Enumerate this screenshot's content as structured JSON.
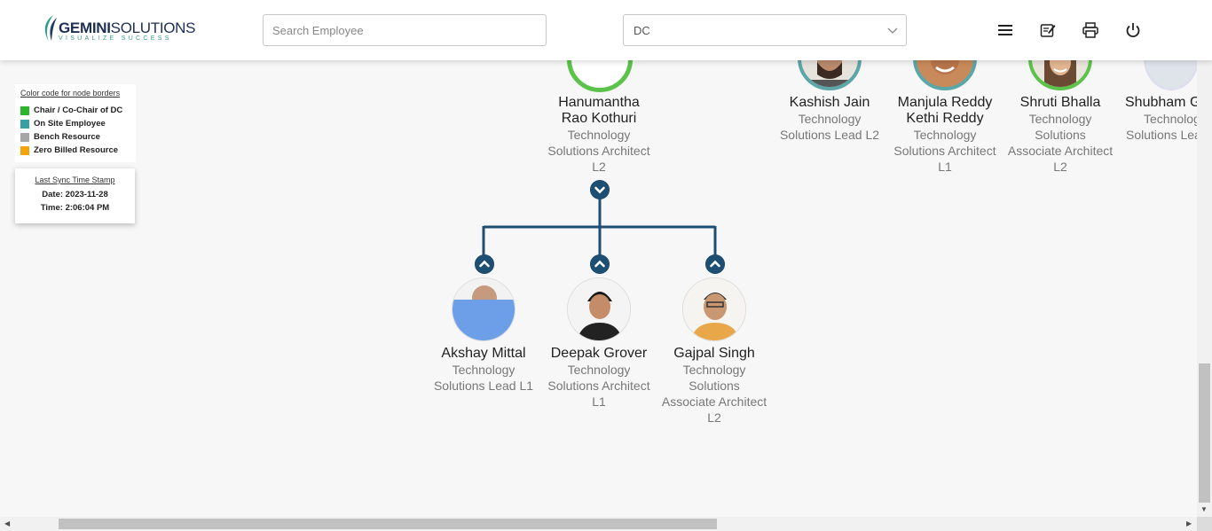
{
  "app": {
    "brand": "GEMINI",
    "brand_suffix": "SOLUTIONS",
    "tagline": "VISUALIZE SUCCESS"
  },
  "header": {
    "search_placeholder": "Search Employee",
    "search_value": "",
    "dc_select": "DC",
    "icons": [
      "menu-icon",
      "notes-icon",
      "print-icon",
      "power-icon"
    ]
  },
  "legend": {
    "title": "Color code for node borders",
    "items": [
      {
        "label": "Chair / Co-Chair of DC",
        "color": "#2db52d"
      },
      {
        "label": "On Site Employee",
        "color": "#3a9fa0"
      },
      {
        "label": "Bench Resource",
        "color": "#a6a6a6"
      },
      {
        "label": "Zero Billed Resource",
        "color": "#f5a50a"
      }
    ]
  },
  "sync": {
    "title": "Last Sync Time Stamp",
    "date": "Date: 2023-11-28",
    "time": "Time: 2:06:04 PM"
  },
  "colors": {
    "connector": "#1f4e73",
    "chair_border": "#5bc24a",
    "onsite_border": "#5aa6a8"
  },
  "nodes": {
    "parent": {
      "name": "Hanumantha Rao Kothuri",
      "name_l1": "Hanumantha",
      "name_l2": "Rao Kothuri",
      "role_l1": "Technology",
      "role_l2": "Solutions Architect",
      "role_l3": "L2"
    },
    "top_row": [
      {
        "name": "Kashish Jain",
        "role_l1": "Technology",
        "role_l2": "Solutions Lead L2"
      },
      {
        "name_l1": "Manjula Reddy",
        "name_l2": "Kethi Reddy",
        "role_l1": "Technology",
        "role_l2": "Solutions Architect",
        "role_l3": "L1"
      },
      {
        "name": "Shruti Bhalla",
        "role_l1": "Technology",
        "role_l2": "Solutions",
        "role_l3": "Associate Architect",
        "role_l4": "L2"
      },
      {
        "name": "Shubham G",
        "role_l1": "Technolog",
        "role_l2": "Solutions Lea"
      }
    ],
    "children": [
      {
        "name": "Akshay Mittal",
        "role_l1": "Technology",
        "role_l2": "Solutions Lead L1"
      },
      {
        "name": "Deepak Grover",
        "role_l1": "Technology",
        "role_l2": "Solutions Architect",
        "role_l3": "L1"
      },
      {
        "name": "Gajpal Singh",
        "role_l1": "Technology",
        "role_l2": "Solutions",
        "role_l3": "Associate Architect",
        "role_l4": "L2"
      }
    ]
  }
}
